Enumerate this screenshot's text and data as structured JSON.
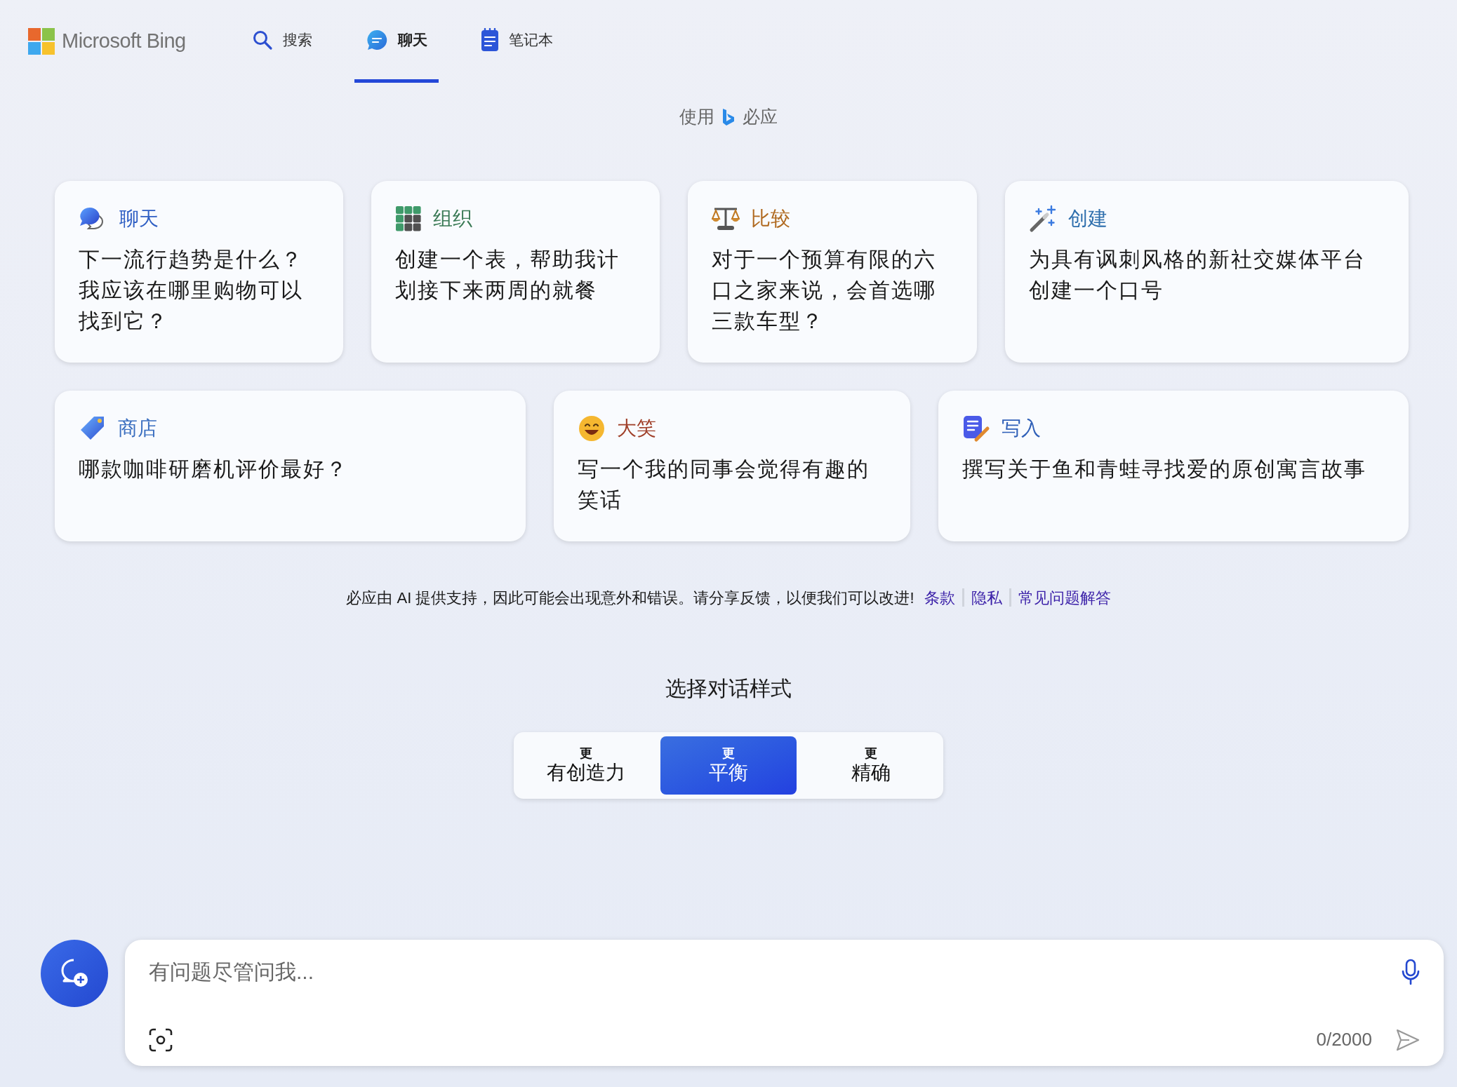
{
  "header": {
    "brand": "Microsoft Bing",
    "tabs": [
      {
        "label": "搜索",
        "kind": "search",
        "selected": false
      },
      {
        "label": "聊天",
        "kind": "chat",
        "selected": true
      },
      {
        "label": "笔记本",
        "kind": "notebook",
        "selected": false
      }
    ]
  },
  "powered_by": {
    "prefix": "使用",
    "name": "必应"
  },
  "card_rows": [
    {
      "cards": [
        {
          "kind": "chat",
          "title": "聊天",
          "color": "#2f5fc4",
          "text": "下一流行趋势是什么？我应该在哪里购物可以找到它？"
        },
        {
          "kind": "grid",
          "title": "组织",
          "color": "#3a7a55",
          "text": "创建一个表，帮助我计划接下来两周的就餐"
        },
        {
          "kind": "scale",
          "title": "比较",
          "color": "#b06a20",
          "text": "对于一个预算有限的六口之家来说，会首选哪三款车型？"
        },
        {
          "kind": "wand",
          "title": "创建",
          "color": "#2f6fad",
          "text": "为具有讽刺风格的新社交媒体平台创建一个口号"
        }
      ]
    },
    {
      "cards": [
        {
          "kind": "tag",
          "title": "商店",
          "color": "#3b6fc0",
          "text": "哪款咖啡研磨机评价最好？"
        },
        {
          "kind": "smile",
          "title": "大笑",
          "color": "#a0402a",
          "text": "写一个我的同事会觉得有趣的笑话"
        },
        {
          "kind": "note",
          "title": "写入",
          "color": "#3060b8",
          "text": "撰写关于鱼和青蛙寻找爱的原创寓言故事"
        }
      ]
    }
  ],
  "disclaimer": {
    "text": "必应由 AI 提供支持，因此可能会出现意外和错误。请分享反馈，以便我们可以改进!",
    "links": [
      "条款",
      "隐私",
      "常见问题解答"
    ]
  },
  "tone": {
    "heading": "选择对话样式",
    "options": [
      {
        "prefix": "更",
        "label": "有创造力",
        "selected": false
      },
      {
        "prefix": "更",
        "label": "平衡",
        "selected": true
      },
      {
        "prefix": "更",
        "label": "精确",
        "selected": false
      }
    ]
  },
  "composer": {
    "placeholder": "有问题尽管问我...",
    "counter": "0/2000"
  }
}
